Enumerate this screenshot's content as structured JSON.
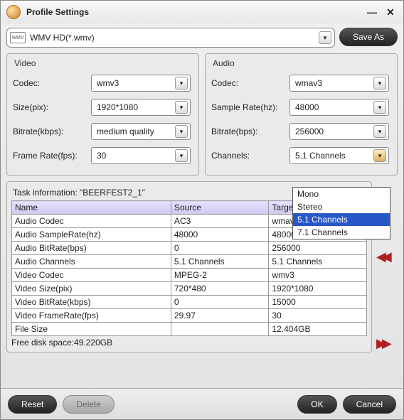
{
  "window": {
    "title": "Profile Settings"
  },
  "profile": {
    "label": "WMV HD(*.wmv)",
    "icon": "WMV"
  },
  "buttons": {
    "saveAs": "Save As",
    "reset": "Reset",
    "delete": "Delete",
    "ok": "OK",
    "cancel": "Cancel"
  },
  "video": {
    "title": "Video",
    "codec": {
      "label": "Codec:",
      "value": "wmv3"
    },
    "size": {
      "label": "Size(pix):",
      "value": "1920*1080"
    },
    "bitrate": {
      "label": "Bitrate(kbps):",
      "value": "medium quality"
    },
    "framerate": {
      "label": "Frame Rate(fps):",
      "value": "30"
    }
  },
  "audio": {
    "title": "Audio",
    "codec": {
      "label": "Codec:",
      "value": "wmav3"
    },
    "samplerate": {
      "label": "Sample Rate(hz):",
      "value": "48000"
    },
    "bitrate": {
      "label": "Bitrate(bps):",
      "value": "256000"
    },
    "channels": {
      "label": "Channels:",
      "value": "5.1 Channels",
      "options": [
        "Mono",
        "Stereo",
        "5.1 Channels",
        "7.1 Channels"
      ]
    }
  },
  "task": {
    "header": "Task information: \"BEERFEST2_1\"",
    "cols": [
      "Name",
      "Source",
      "Target"
    ],
    "rows": [
      [
        "Audio Codec",
        "AC3",
        "wmav3"
      ],
      [
        "Audio SampleRate(hz)",
        "48000",
        "48000"
      ],
      [
        "Audio BitRate(bps)",
        "0",
        "256000"
      ],
      [
        "Audio Channels",
        "5.1 Channels",
        "5.1 Channels"
      ],
      [
        "Video Codec",
        "MPEG-2",
        "wmv3"
      ],
      [
        "Video Size(pix)",
        "720*480",
        "1920*1080"
      ],
      [
        "Video BitRate(kbps)",
        "0",
        "15000"
      ],
      [
        "Video FrameRate(fps)",
        "29.97",
        "30"
      ],
      [
        "File Size",
        "",
        "12.404GB"
      ]
    ],
    "free": "Free disk space:49.220GB"
  }
}
